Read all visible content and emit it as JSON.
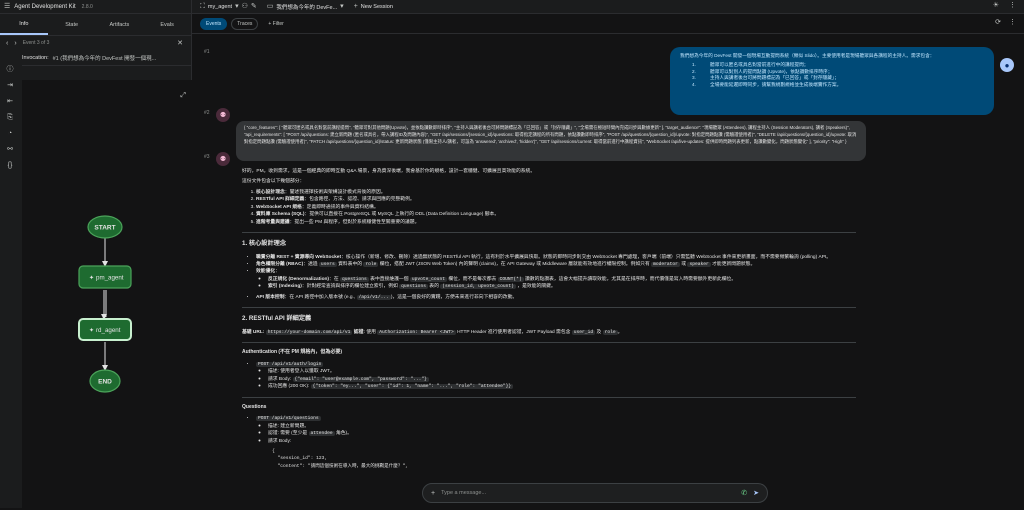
{
  "app": {
    "title": "Agent Development Kit",
    "version": "2.8.0"
  },
  "agent_select": {
    "value": "my_agent"
  },
  "session_select": {
    "value": "我們想為今年的 DevFe..."
  },
  "new_session_label": "New Session",
  "left_tabs": [
    "Info",
    "State",
    "Artifacts",
    "Evals"
  ],
  "event_nav": {
    "label": "Event 3 of 3"
  },
  "invocation": {
    "label": "Invocation:",
    "value": "#1 (我們想為今年的 DevFest 開發一個現..."
  },
  "graph": {
    "nodes": [
      {
        "label": "START",
        "kind": "terminal"
      },
      {
        "label": "pm_agent",
        "kind": "agent"
      },
      {
        "label": "rd_agent",
        "kind": "agent-active"
      },
      {
        "label": "END",
        "kind": "terminal"
      }
    ],
    "colors": {
      "fill": "#1e6b30",
      "stroke": "#4ba35a",
      "edge": "#e3e3e3",
      "active_stroke": "#c8f0cf"
    }
  },
  "main_tabs": [
    "Events",
    "Traces"
  ],
  "filter_label": "Filter",
  "events": [
    {
      "num": "#1",
      "role": "user",
      "lead": "我們想為今年的 DevFest 開發一個現場互動提問系統（類似 Slido）。主要使用者是現場聽眾與各講程的主持人。需求包含：",
      "items": [
        {
          "n": "1.",
          "text": "聽眾可以匿名或具名對當前進行中的講程提問；"
        },
        {
          "n": "2.",
          "text": "聽眾可以對別人的提問點讚 (Upvote)，依點讚數排序時序；"
        },
        {
          "n": "3.",
          "text": "主持人與講者後台可將問題標記為「已回答」或「封存隱藏」；"
        },
        {
          "n": "4.",
          "text": "全場要能延遲即時同步，請幫我規劃規格並生成後端實作方案。"
        }
      ]
    },
    {
      "num": "#2",
      "role": "function_call",
      "text": "{ \"core_features\": [ \"聽眾可匿名或具名對當前講程提問\", \"聽眾可對其他問題(Upvote)，並依點讚數即時排序\", \"主持人與講者後台可將問題標記為「已回答」或「封存隱藏」\", \"全場需在極短時間內完成同步與數據更新\" ], \"target_audience\": \"現場聽眾 (Attendees), 講程主持人 (Session Moderators), 講者 (Speakers)\", \"api_requirements\": [ \"POST /api/questions: 建立新問題 (匿名或具名，帶入講程ID及問題內容)\", \"GET /api/sessions/{session_id}/questions: 取得指定講程的所有問題，依點讚數即時排序\", \"POST /api/questions/{question_id}/upvote: 對指定問題點讚 (需驗證使用者)\", \"DELETE /api/questions/{question_id}/upvote: 取消對指定問題點讚 (需驗證使用者)\", \"PATCH /api/questions/{question_id}/status: 更新問題狀態 (僅限主持人/講者，可設為 'answered', 'archived', 'hidden')\", \"GET /api/sessions/current: 取得當前進行中講程資訊\", \"WebSocket /api/live-updates: 提供即時問題列表更新，點讚數變化，問題狀態變化\" ], \"priority\": \"High\" }"
    },
    {
      "num": "#3",
      "role": "model",
      "intro": "好的，PM。收到需求，這是一個經典的即時互動 Q&A 場景，身為資深後端，我會基於你的規格，設計一套穩健、可擴展且高效能的系統。",
      "intro2": "這份文件包含以下幾個部分：",
      "toc": [
        {
          "b": "核心設計理念",
          "t": "：闡述我選擇技術與架構設計模式背後的原因。"
        },
        {
          "b": "RESTful API 詳細定義",
          "t": "：包含路徑、方法、認證、請求與回應的完整範例。"
        },
        {
          "b": "WebSocket API 規格",
          "t": "：定義即時通訊的事件與資料結構。"
        },
        {
          "b": "資料庫 Schema (SQL)",
          "t": "：提供可以直接在 PostgreSQL 或 MySQL 上執行的 DDL (Data Definition Language) 腳本。"
        },
        {
          "b": "進階考量與建議",
          "t": "：提出一些 PM 與程序，但對於系統穩健性至關重要的議題。"
        }
      ],
      "h1": "1. 核心設計理念",
      "design": [
        {
          "b": "職責分離 REST + 資源導向 WebSocket",
          "t": "：核心操作（新增、修改、刪除）透過無狀態的 RESTful API 執行，這有利於水平擴展與快取。狀態的即時同步則交由 WebSocket 專門處理，客戶端（前端）只需監聽 WebSocket 事件來更新畫面，而不需要頻繁輪詢 (polling) API。"
        },
        {
          "b": "角色權限分離 (RBAC)",
          "t": "：透過",
          "c1": "users",
          "t2": "資料表中的",
          "c2": "role",
          "t3": "欄位，搭配 JWT (JSON Web Token) 內的聲明 (claims)，在 API Gateway 或 Middleware 層就能有效地進行權限控制。例如只有",
          "c3": "moderator",
          "t4": "或",
          "c4": "speaker",
          "t5": "才能更新問題狀態。"
        },
        {
          "b": "效能優化",
          "t": "："
        }
      ],
      "perf": [
        {
          "b": "反正規化 (Denormalization)",
          "t": "：在",
          "c1": "questions",
          "t2": "表中直接維護一個",
          "c2": "upvote_count",
          "t3": "欄位，而不是每次都去",
          "c3": "COUNT(*)",
          "t4": "讚數的點讚表，這會大幅提升讀取效能，尤其是在排序時，而代價僅是寫入時需要額外更新此欄位。"
        },
        {
          "b": "索引 (Indexing)",
          "t": "：針對經常查詢與排序的欄位建立索引，例如",
          "c1": "questions",
          "t2": "表的",
          "c2": "(session_id, upvote_count)",
          "t3": "，是效能的關鍵。"
        }
      ],
      "versioning": {
        "b": "API 版本控制",
        "t": "：在 API 路徑中加入版本號 (e.g.,",
        "c1": "/api/v1/...",
        "t2": ")，這是一個良好的實踐，方便未來進行非向下相容的改動。"
      },
      "h2": "2. RESTful API 詳細定義",
      "base_url": {
        "b": "基礎 URL:",
        "c1": "https://your-domain.com/api/v1",
        "b2": "認證:",
        "t": "使用",
        "c2": "Authorization: Bearer <JWT>",
        "t2": "HTTP Header 進行使用者認證，JWT Payload 需包含",
        "c3": "user_id",
        "t3": "及",
        "c4": "role",
        "t4": "。"
      },
      "auth_h": "Authentication (不在 PM 規格內，但為必要)",
      "login": {
        "code": "POST /api/v1/auth/login",
        "sub": [
          {
            "t": "描述: 使用者登入以獲取 JWT。"
          },
          {
            "t": "請求 Body:",
            "c": "{\"email\": \"user@example.com\", \"password\": \"...\"}"
          },
          {
            "t": "成功回應 (200 OK):",
            "c": "{\"token\": \"ey...\", \"user\": {\"id\": 1, \"name\": \"...\", \"role\": \"attendee\"}}"
          }
        ]
      },
      "questions_h": "Questions",
      "qpost": {
        "code": "POST /api/v1/questions",
        "sub": [
          {
            "t": "描述: 建立新問題。"
          },
          {
            "t": "認證: 需要 (至少是",
            "c": "attendee",
            "t2": "角色)。"
          },
          {
            "t": "請求 Body:"
          }
        ]
      },
      "code_lines": [
        "{",
        "  \"session_id\": 123,",
        "  \"content\": \"請問這個技術在導入時，最大的挑戰是什麼？\","
      ]
    }
  ],
  "input": {
    "placeholder": "Type a message..."
  }
}
